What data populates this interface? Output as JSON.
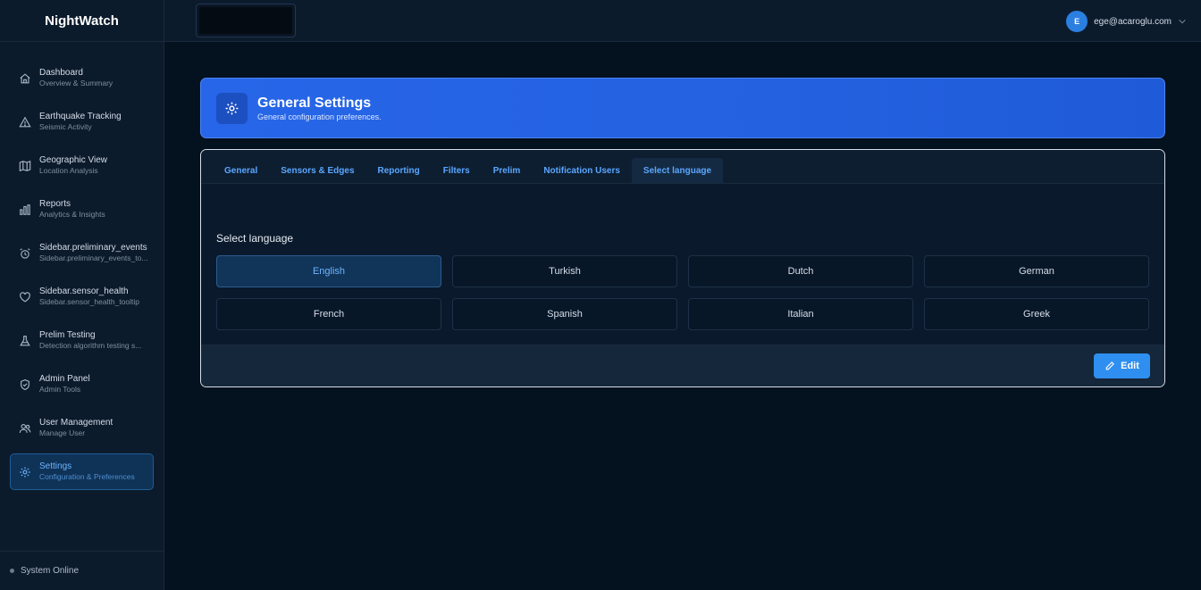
{
  "app": {
    "name": "NightWatch"
  },
  "sidebar": {
    "items": [
      {
        "label": "Dashboard",
        "sub": "Overview & Summary",
        "icon": "home-icon"
      },
      {
        "label": "Earthquake Tracking",
        "sub": "Seismic Activity",
        "icon": "warning-icon"
      },
      {
        "label": "Geographic View",
        "sub": "Location Analysis",
        "icon": "map-icon"
      },
      {
        "label": "Reports",
        "sub": "Analytics & Insights",
        "icon": "bar-chart-icon"
      },
      {
        "label": "Sidebar.preliminary_events",
        "sub": "Sidebar.preliminary_events_to...",
        "icon": "alarm-icon"
      },
      {
        "label": "Sidebar.sensor_health",
        "sub": "Sidebar.sensor_health_tooltip",
        "icon": "heart-icon"
      },
      {
        "label": "Prelim Testing",
        "sub": "Detection algorithm testing s...",
        "icon": "flask-icon"
      },
      {
        "label": "Admin Panel",
        "sub": "Admin Tools",
        "icon": "shield-check-icon"
      },
      {
        "label": "User Management",
        "sub": "Manage User",
        "icon": "users-icon"
      },
      {
        "label": "Settings",
        "sub": "Configuration & Preferences",
        "icon": "gear-icon",
        "active": true
      }
    ],
    "status": "System Online"
  },
  "topbar": {
    "avatar_initial": "E",
    "user_email": "ege@acaroglu.com"
  },
  "header": {
    "title": "General Settings",
    "subtitle": "General configuration preferences.",
    "icon": "gear-icon"
  },
  "tabs": [
    {
      "label": "General"
    },
    {
      "label": "Sensors & Edges"
    },
    {
      "label": "Reporting"
    },
    {
      "label": "Filters"
    },
    {
      "label": "Prelim"
    },
    {
      "label": "Notification Users"
    },
    {
      "label": "Select language",
      "active": true
    }
  ],
  "language": {
    "title": "Select language",
    "selected": "English",
    "options": [
      "English",
      "Turkish",
      "Dutch",
      "German",
      "French",
      "Spanish",
      "Italian",
      "Greek"
    ]
  },
  "actions": {
    "edit_label": "Edit"
  },
  "colors": {
    "accent": "#2f8ff0",
    "header_gradient": "#2766e8",
    "background": "#04111f",
    "sidebar": "#0c1b2c",
    "active_text": "#6cb6ff"
  }
}
